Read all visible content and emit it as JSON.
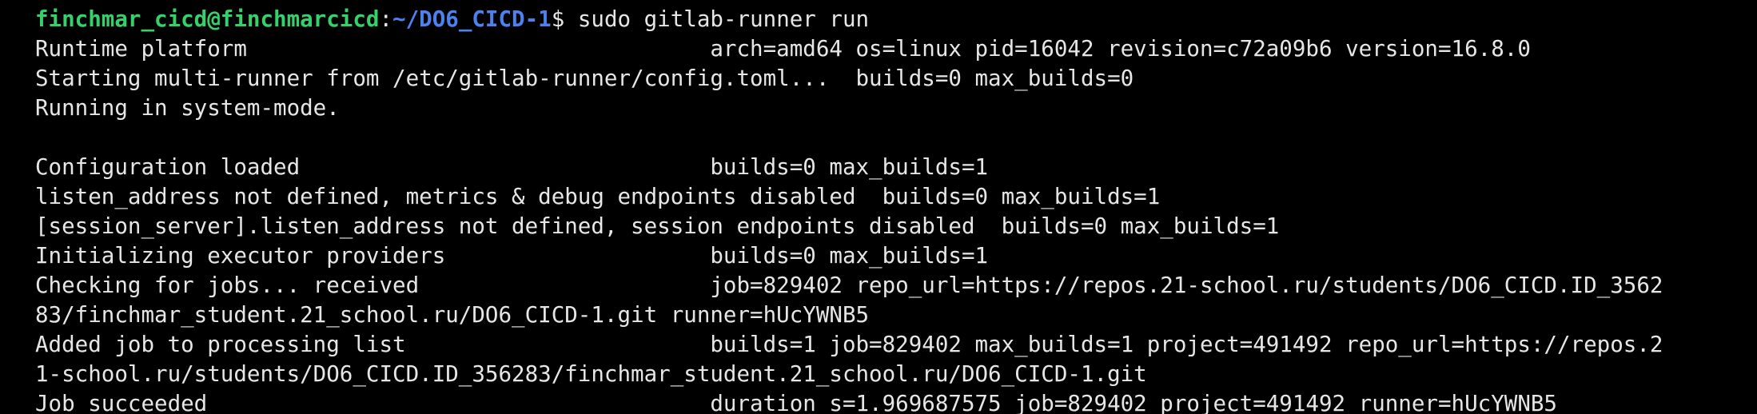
{
  "terminal": {
    "background": "#000000",
    "foreground": "#e6e6e6",
    "prompt_user_color": "#35d16b",
    "prompt_path_color": "#4b82f0",
    "prompt": {
      "user_host": "finchmar_cicd@finchmarcicd",
      "colon": ":",
      "cwd": "~/DO6_CICD-1",
      "symbol": "$ ",
      "command": "sudo gitlab-runner run"
    },
    "output_lines": [
      "Runtime platform                                   arch=amd64 os=linux pid=16042 revision=c72a09b6 version=16.8.0",
      "Starting multi-runner from /etc/gitlab-runner/config.toml...  builds=0 max_builds=0",
      "Running in system-mode.",
      "",
      "Configuration loaded                               builds=0 max_builds=1",
      "listen_address not defined, metrics & debug endpoints disabled  builds=0 max_builds=1",
      "[session_server].listen_address not defined, session endpoints disabled  builds=0 max_builds=1",
      "Initializing executor providers                    builds=0 max_builds=1",
      "Checking for jobs... received                      job=829402 repo_url=https://repos.21-school.ru/students/DO6_CICD.ID_3562",
      "83/finchmar_student.21_school.ru/DO6_CICD-1.git runner=hUcYWNB5",
      "Added job to processing list                       builds=1 job=829402 max_builds=1 project=491492 repo_url=https://repos.2",
      "1-school.ru/students/DO6_CICD.ID_356283/finchmar_student.21_school.ru/DO6_CICD-1.git",
      "Job succeeded                                      duration_s=1.969687575 job=829402 project=491492 runner=hUcYWNB5"
    ]
  }
}
